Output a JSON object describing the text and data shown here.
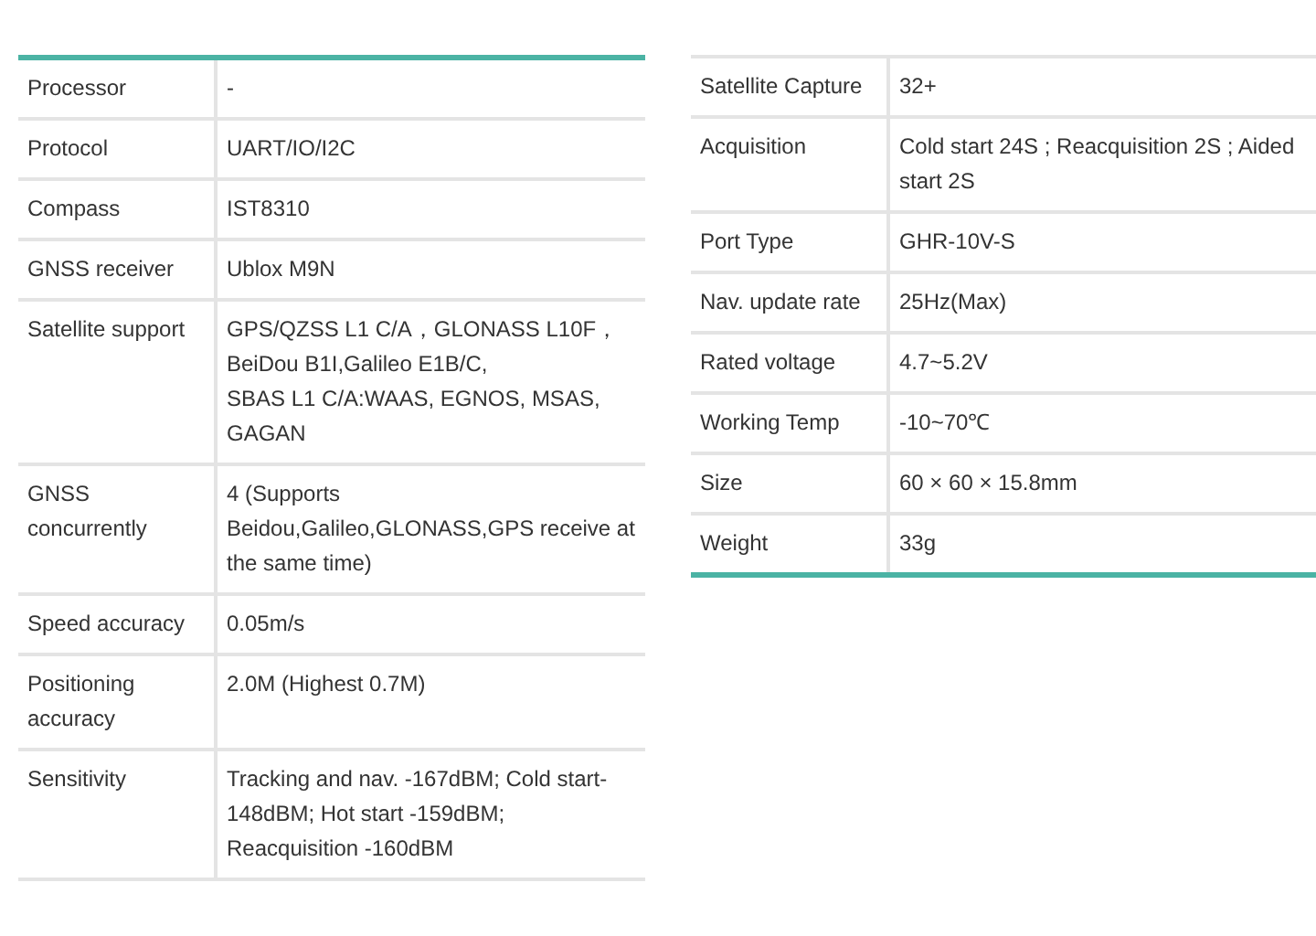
{
  "tables": [
    {
      "accent_top": true,
      "accent_bottom": false,
      "rows": [
        {
          "label": "Processor",
          "value": "-"
        },
        {
          "label": "Protocol",
          "value": "UART/IO/I2C"
        },
        {
          "label": "Compass",
          "value": "IST8310"
        },
        {
          "label": "GNSS receiver",
          "value": "Ublox M9N"
        },
        {
          "label": "Satellite support",
          "value": "GPS/QZSS L1 C/A，GLONASS L10F，BeiDou B1I,Galileo E1B/C,\nSBAS L1 C/A:WAAS, EGNOS, MSAS, GAGAN"
        },
        {
          "label": "GNSS concurrently",
          "value": "4 (Supports Beidou,Galileo,GLONASS,GPS receive at the same time)"
        },
        {
          "label": "Speed accuracy",
          "value": "0.05m/s"
        },
        {
          "label": "Positioning accuracy",
          "value": "2.0M (Highest 0.7M)"
        },
        {
          "label": "Sensitivity",
          "value": "Tracking and nav. -167dBM; Cold start-148dBM; Hot start -159dBM; Reacquisition -160dBM"
        }
      ]
    },
    {
      "accent_top": false,
      "accent_bottom": true,
      "rows": [
        {
          "label": "Satellite Capture",
          "value": "32+"
        },
        {
          "label": "Acquisition",
          "value": "Cold start 24S ; Reacquisition 2S ; Aided start 2S"
        },
        {
          "label": "Port Type",
          "value": "GHR-10V-S"
        },
        {
          "label": "Nav. update rate",
          "value": "25Hz(Max)"
        },
        {
          "label": "Rated voltage",
          "value": "4.7~5.2V"
        },
        {
          "label": "Working Temp",
          "value": "-10~70℃"
        },
        {
          "label": "Size",
          "value": "60 × 60 × 15.8mm"
        },
        {
          "label": "Weight",
          "value": "33g"
        }
      ]
    }
  ]
}
